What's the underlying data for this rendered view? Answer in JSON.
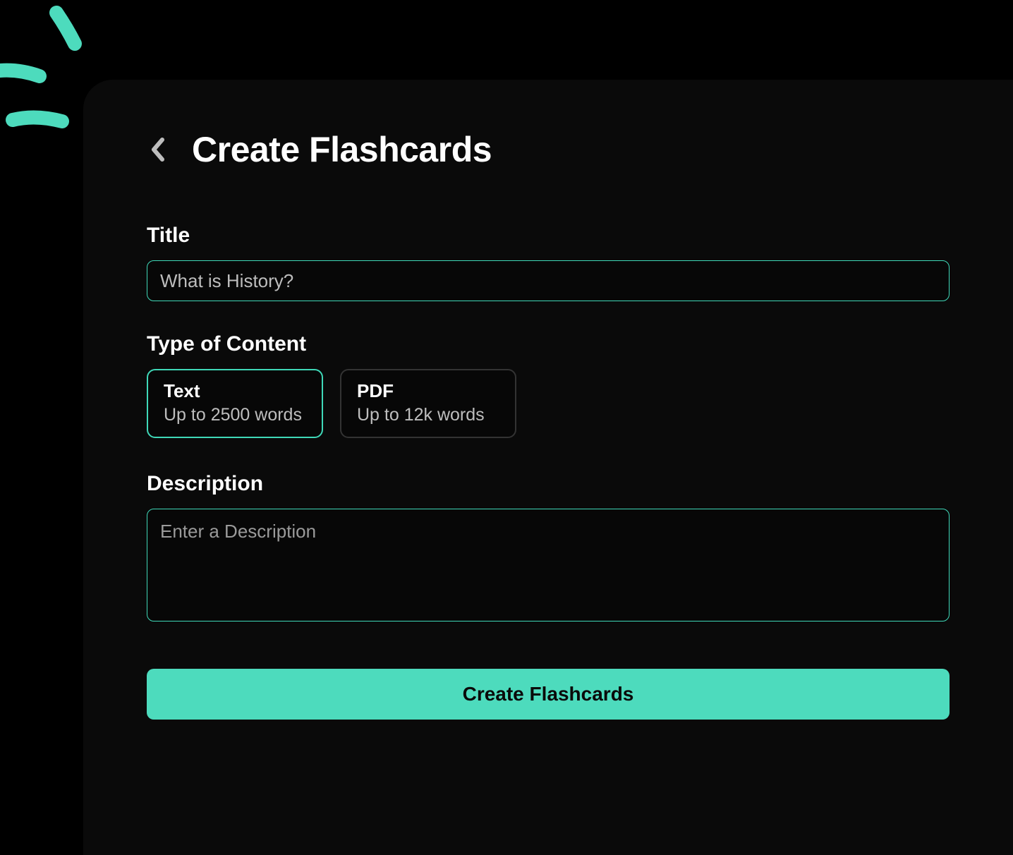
{
  "header": {
    "title": "Create Flashcards"
  },
  "form": {
    "title_label": "Title",
    "title_value": "What is History?",
    "content_type_label": "Type of Content",
    "content_types": [
      {
        "name": "Text",
        "limit": "Up to 2500 words",
        "selected": true
      },
      {
        "name": "PDF",
        "limit": "Up to 12k words",
        "selected": false
      }
    ],
    "description_label": "Description",
    "description_placeholder": "Enter a Description",
    "submit_label": "Create Flashcards"
  },
  "colors": {
    "accent": "#4ddbbd",
    "accent_border": "#3fd8b8",
    "card_bg": "#0a0a0a",
    "text_muted": "#bdbdbd"
  }
}
